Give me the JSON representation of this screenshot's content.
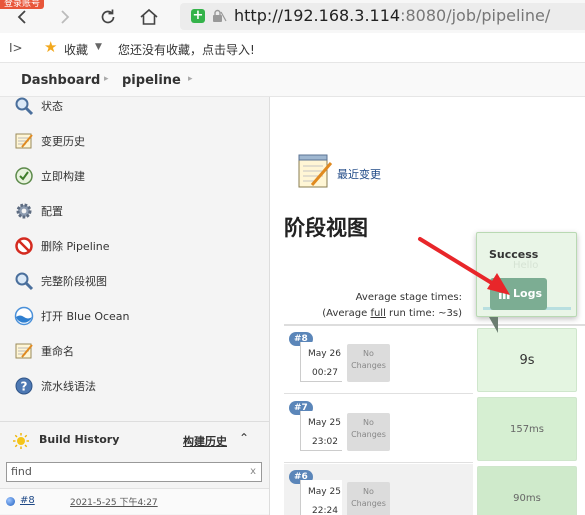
{
  "browser": {
    "login_tag": "登录账号",
    "url_host": "http://192.168.3.114",
    "url_rest": ":8080/job/pipeline/"
  },
  "bookmarks": {
    "label": "收藏",
    "hint": "您还没有收藏，点击导入!"
  },
  "breadcrumb": [
    "Dashboard",
    "pipeline"
  ],
  "sidebar": {
    "items": [
      {
        "label": "状态",
        "icon": "magnifier-icon"
      },
      {
        "label": "变更历史",
        "icon": "notepad-icon"
      },
      {
        "label": "立即构建",
        "icon": "build-now-icon"
      },
      {
        "label": "配置",
        "icon": "gear-icon"
      },
      {
        "label": "删除 Pipeline",
        "icon": "no-entry-icon"
      },
      {
        "label": "完整阶段视图",
        "icon": "magnifier-icon"
      },
      {
        "label": "打开 Blue Ocean",
        "icon": "blue-ocean-icon"
      },
      {
        "label": "重命名",
        "icon": "notepad-icon"
      },
      {
        "label": "流水线语法",
        "icon": "help-icon"
      }
    ]
  },
  "build_history": {
    "title": "Build History",
    "link": "构建历史",
    "find_placeholder": "find",
    "find_clear": "x",
    "builds": [
      {
        "number": "#8",
        "date": "2021-5-25 下午4:27"
      }
    ]
  },
  "main": {
    "recent_changes": "最近变更",
    "stage_view_title": "阶段视图",
    "avg_label": "Average stage times:",
    "avg_sub_prefix": "(Average ",
    "avg_sub_link": "full",
    "avg_sub_suffix": " run time: ~3s)",
    "runs": [
      {
        "badge": "#8",
        "date": "May 26",
        "time": "00:27",
        "changes": "No Changes",
        "stage_time": "9s"
      },
      {
        "badge": "#7",
        "date": "May 25",
        "time": "23:02",
        "changes": "No Changes",
        "stage_time": "157ms"
      },
      {
        "badge": "#6",
        "date": "May 25",
        "time": "22:24",
        "changes": "No Changes",
        "stage_time": "90ms"
      }
    ],
    "popup": {
      "title": "Success",
      "sub": "Hello",
      "logs_button": "Logs"
    }
  },
  "colors": {
    "success_stage": "#e4f5e1",
    "logs_button": "#7cad93",
    "badge": "#5b86b9",
    "annotation_arrow": "#e8262a"
  }
}
